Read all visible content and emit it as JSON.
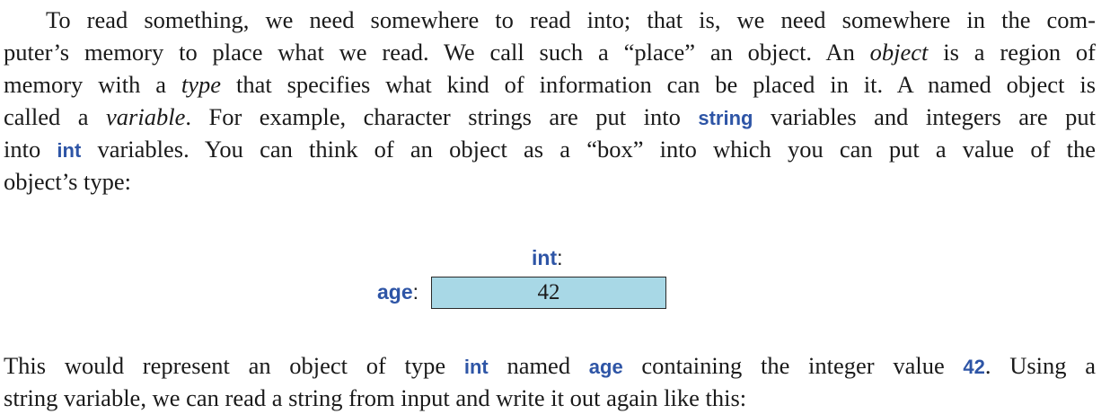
{
  "paragraph1": {
    "l1": "To read something, we need somewhere to read into; that is, we need somewhere in the com-",
    "l2": "puter’s memory to place what we read. We call such a “place” an object. An",
    "l2_em": "object",
    "l2_tail": "is a region of",
    "l3_a": "memory with a",
    "l3_em": "type",
    "l3_b": "that specifies what kind of information can be placed in it.  A named object is",
    "l4_a": "called a",
    "l4_em": "variable",
    "l4_b": ".  For example, character strings are put into",
    "l4_code": "string",
    "l4_c": "variables and integers are put",
    "l5_a": "into",
    "l5_code": "int",
    "l5_b": "variables.  You can think of an object as a “box” into which you can put a value of the",
    "l6": "object’s type:"
  },
  "diagram": {
    "type_name": "int",
    "type_suffix": ":",
    "var_name": "age",
    "var_suffix": ":",
    "value": "42",
    "box_color": "#a8d8e6"
  },
  "paragraph2": {
    "l1_a": "This would represent an object of type",
    "l1_code1": "int",
    "l1_b": "named",
    "l1_code2": "age",
    "l1_c": "containing the integer value",
    "l1_code3": "42",
    "l1_d": ".  Using a",
    "l2": "string variable, we can read a string from input and write it out again like this:"
  },
  "colors": {
    "code": "#2e55a6",
    "text": "#1a1a1a"
  }
}
